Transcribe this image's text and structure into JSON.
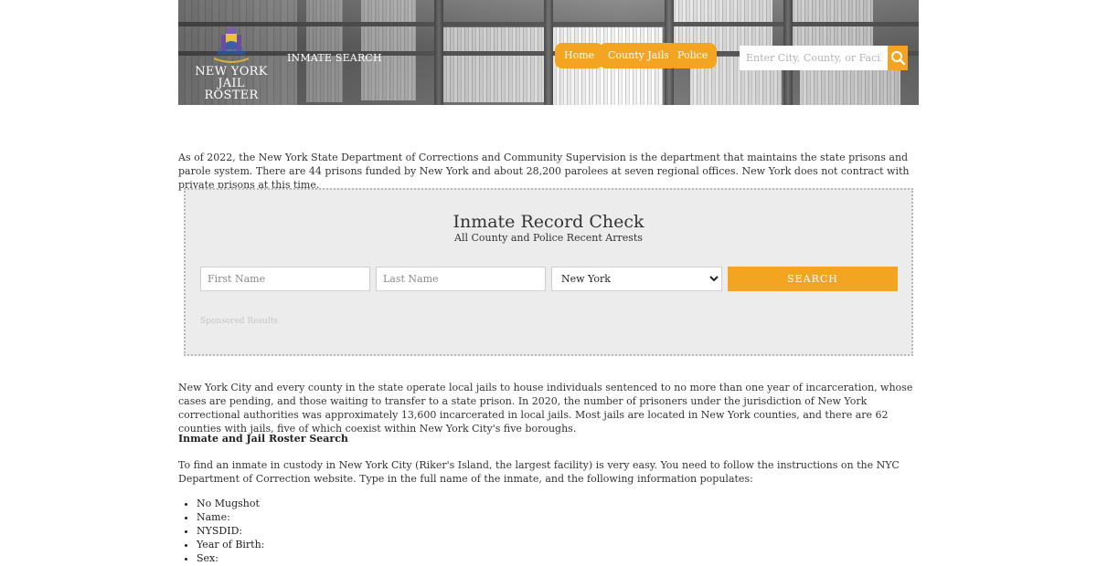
{
  "header": {
    "logo_line1": "NEW YORK",
    "logo_line2": "JAIL ROSTER",
    "inmate_search_link": "INMATE SEARCH",
    "nav": [
      "Home",
      "County Jails",
      "Police"
    ],
    "search_placeholder": "Enter City, County, or Facility",
    "accent_color": "#f3a521"
  },
  "intro": "As of 2022, the New York State Department of Corrections and Community Supervision is the department that maintains the state prisons and parole system. There are 44 prisons funded by New York and about 28,200 parolees at seven regional offices. New York does not contract with private prisons at this time.",
  "record_check": {
    "title": "Inmate Record Check",
    "subtitle": "All County and Police Recent Arrests",
    "first_name_placeholder": "First Name",
    "last_name_placeholder": "Last Name",
    "state_selected": "New York",
    "search_label": "SEARCH",
    "sponsored": "Sponsored Results"
  },
  "body": {
    "para1": "New York City and every county in the state operate local jails to house individuals sentenced to no more than one year of incarceration, whose cases are pending, and those waiting to transfer to a state prison. In 2020, the number of prisoners under the jurisdiction of New York correctional authorities was approximately 13,600 incarcerated in local jails. Most jails are located in New York counties, and there are 62 counties with jails, five of which coexist within New York City's five boroughs.",
    "heading": "Inmate and Jail Roster Search",
    "para2": "To find an inmate in custody in New York City (Riker's Island, the largest facility) is very easy. You need to follow the instructions on the NYC Department of Correction website. Type in the full name of the inmate, and the following information populates:",
    "list": [
      "No Mugshot",
      "Name:",
      "NYSDID:",
      "Year of Birth:",
      "Sex:"
    ]
  }
}
